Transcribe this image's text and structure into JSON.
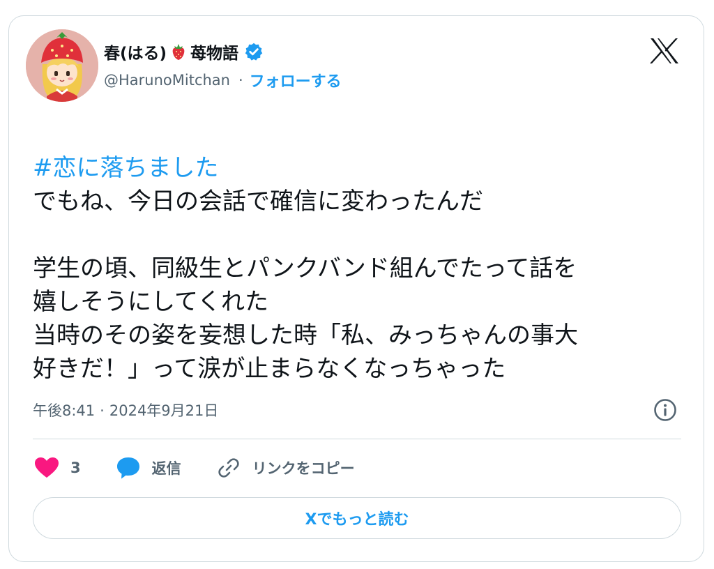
{
  "author": {
    "display_name_part1": "春(はる)",
    "display_name_part2": "苺物語",
    "handle": "@HarunoMitchan",
    "separator": "·",
    "follow_label": "フォローする",
    "verified": true,
    "name_emoji": "strawberry-icon"
  },
  "platform": {
    "logo": "x-logo-icon"
  },
  "tweet": {
    "hashtag": "#恋に落ちました",
    "lines": [
      "でもね、今日の会話で確信に変わったんだ",
      "",
      "学生の頃、同級生とパンクバンド組んでたって話を",
      "嬉しそうにしてくれた",
      "当時のその姿を妄想した時「私、みっちゃんの事大",
      "好きだ！」って涙が止まらなくなっちゃった"
    ]
  },
  "meta": {
    "time": "午後8:41",
    "separator": "·",
    "date": "2024年9月21日",
    "info_icon": "info-icon"
  },
  "actions": {
    "like_count": "3",
    "reply_label": "返信",
    "copy_link_label": "リンクをコピー"
  },
  "read_more_label": "Xでもっと読む",
  "colors": {
    "accent": "#1d9bf0",
    "like": "#f91880",
    "text": "#0f1419",
    "muted": "#536471",
    "border": "#cfd9de"
  }
}
